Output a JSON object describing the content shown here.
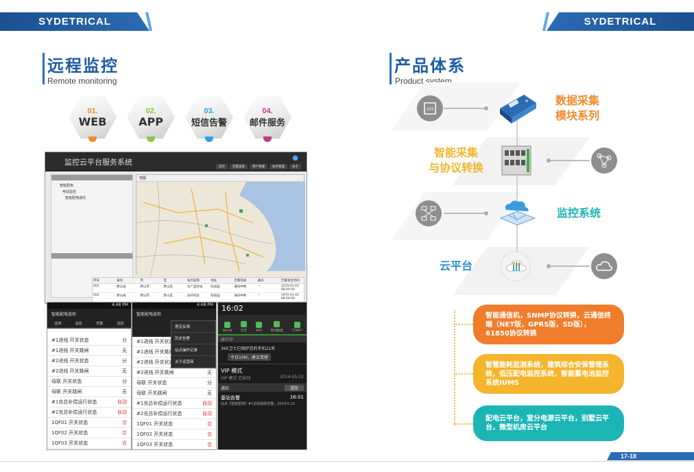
{
  "brand": "SYDETRICAL",
  "left": {
    "title": "远程监控",
    "subtitle": "Remote monitoring",
    "channels": [
      {
        "num": "01.",
        "label": "WEB",
        "color": "#f08a2b"
      },
      {
        "num": "02.",
        "label": "APP",
        "color": "#8cc63f"
      },
      {
        "num": "03.",
        "label": "短信告警",
        "color": "#2ba3df"
      },
      {
        "num": "04.",
        "label": "邮件服务",
        "color": "#c23a8c"
      }
    ],
    "web_screen": {
      "title": "监控云平台服务系统",
      "nav": [
        "首页",
        "告警查看",
        "用户管理",
        "站点管理",
        "关于"
      ],
      "tree": [
        "智能配电",
        "电站监控",
        "智能配电通讯"
      ],
      "panel_label": "地图",
      "table_headers": [
        "序号",
        "省份",
        "市",
        "区",
        "站点名称",
        "地址",
        "告警等级",
        "通讯",
        "告警发生时间"
      ],
      "table_rows": [
        [
          "001",
          "黔山省",
          "黔山市",
          "黔山区",
          "水厂监控站",
          "科技园",
          "通讯中断",
          "—",
          "1970-01-01 08:00:00"
        ],
        [
          "002",
          "黔山省",
          "黔山市",
          "黔山区",
          "光纤机房",
          "科技园",
          "通讯中断",
          "—",
          "1970-01-01 08:00:00"
        ]
      ]
    },
    "app_screen_1": {
      "status_time": "4:48 PM",
      "title": "智能配电巡检",
      "tabs": [
        "遥测",
        "遥信",
        "告警",
        "遥控"
      ],
      "rows": [
        [
          "#1进线 开关状态",
          "分"
        ],
        [
          "#1进线 开关跳闸",
          "无"
        ],
        [
          "#2进线 开关状态",
          "分"
        ],
        [
          "#2进线 开关跳闸",
          "无"
        ],
        [
          "母联 开关状态",
          "分"
        ],
        [
          "母联 开关跳闸",
          "无"
        ],
        [
          "#1充总补偿运行状态",
          "自动"
        ],
        [
          "#2充总补偿运行状态",
          "自动"
        ],
        [
          "1QF01 开关状态",
          "合"
        ],
        [
          "1QF02 开关状态",
          "合"
        ],
        [
          "1QF03 开关状态",
          "合"
        ]
      ]
    },
    "app_screen_2": {
      "status_time": "4:48 PM",
      "title": "智能配电巡检",
      "menu": [
        "意见反馈",
        "历史告警",
        "站点操作记录",
        "关于运营商"
      ],
      "rows": [
        [
          "#1进线 开关状态",
          "分"
        ],
        [
          "#1进线 开关跳闸",
          "无"
        ],
        [
          "#2进线 开关状态",
          "分"
        ],
        [
          "#2进线 开关跳闸",
          "无"
        ],
        [
          "母联 开关状态",
          "分"
        ],
        [
          "母联 开关跳闸",
          "无"
        ],
        [
          "#1充总补偿运行状态",
          "自动"
        ],
        [
          "#2充总补偿运行状态",
          "自动"
        ],
        [
          "1QF01 开关状态",
          "合"
        ],
        [
          "1QF02 开关状态",
          "合"
        ],
        [
          "1QF03 开关状态",
          "合"
        ]
      ]
    },
    "notify_screen": {
      "time": "16:02",
      "toggles": [
        "WLAN",
        "声音",
        "GPS",
        "移动数据",
        "CTNET"
      ],
      "running": "进行中",
      "notif1": "360卫士已保护您的手机22天",
      "notif1_btn": "今日10M，建议清理",
      "vip_title": "VIP 模式",
      "vip_sub": "VIP 模式 已启动",
      "vip_date": "2014-05-22",
      "notice_label": "通知",
      "clear_btn": "清除",
      "alarm_title": "基站告警",
      "alarm_time": "16:01",
      "alarm_body": "站点【智能配电】#1进线跳闸告警，2014-5-21"
    }
  },
  "right": {
    "title": "产品体系",
    "subtitle": "Product system",
    "items": [
      {
        "label": "数据采集\n模块系列",
        "color": "#f08a2b"
      },
      {
        "label": "智能采集\n与协议转换",
        "color": "#f2b62b"
      },
      {
        "label": "监控系统",
        "color": "#1bb3b3"
      },
      {
        "label": "云平台",
        "color": "#2b8fd0"
      }
    ],
    "pills": [
      {
        "text": "智能通信机，SNMP协议转换，云通信终端（NET版，GPRS版，SD版），61850协议转换",
        "color": "#f07d2b"
      },
      {
        "text": "智慧能耗监测系统，建筑综合安保管理系统，低压配电监控系统，智能蓄电池监控系统IUMS",
        "color": "#f5b52c"
      },
      {
        "text": "配电云平台，室分电源云平台，别墅云平台，微型机房云平台",
        "color": "#1cb5b5"
      }
    ]
  },
  "page_number": "17-18"
}
